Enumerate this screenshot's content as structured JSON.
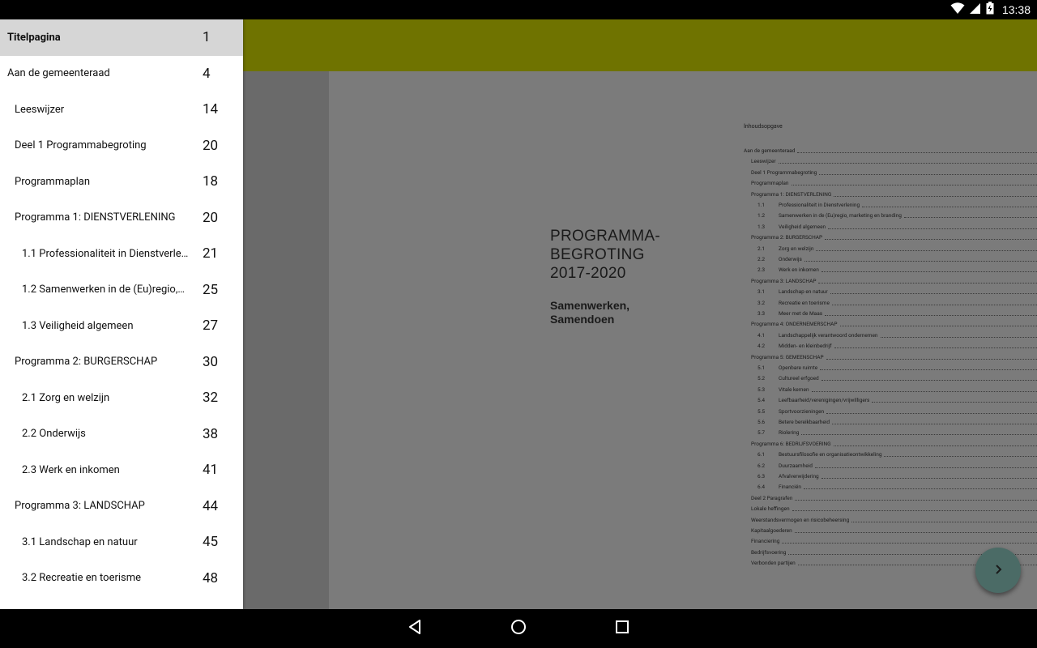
{
  "status_bar": {
    "time": "13:38"
  },
  "cover": {
    "title": "PROGRAMMA-\nBEGROTING\n2017-2020",
    "subtitle": "Samenwerken,\nSamendoen"
  },
  "drawer": {
    "items": [
      {
        "label": "Titelpagina",
        "page": "1"
      },
      {
        "label": "Aan de gemeenteraad",
        "page": "4"
      },
      {
        "label": "Leeswijzer",
        "page": "14"
      },
      {
        "label": "Deel 1 Programmabegroting",
        "page": "20"
      },
      {
        "label": "Programmaplan",
        "page": "18"
      },
      {
        "label": "Programma 1:  DIENSTVERLENING",
        "page": "20"
      },
      {
        "label": "1.1   Professionaliteit in Dienstverle…",
        "page": "21"
      },
      {
        "label": "1.2   Samenwerken in de (Eu)regio,…",
        "page": "25"
      },
      {
        "label": "1.3   Veiligheid algemeen",
        "page": "27"
      },
      {
        "label": "Programma 2:  BURGERSCHAP",
        "page": "30"
      },
      {
        "label": "2.1   Zorg en welzijn",
        "page": "32"
      },
      {
        "label": "2.2   Onderwijs",
        "page": "38"
      },
      {
        "label": "2.3   Werk en inkomen",
        "page": "41"
      },
      {
        "label": "Programma 3:  LANDSCHAP",
        "page": "44"
      },
      {
        "label": "3.1   Landschap en natuur",
        "page": "45"
      },
      {
        "label": "3.2   Recreatie en toerisme",
        "page": "48"
      }
    ]
  },
  "toc_page": {
    "heading": "Inhoudsopgave",
    "lines": [
      {
        "num": "",
        "text": "Aan de gemeenteraad"
      },
      {
        "num": "",
        "text": "Leeswijzer"
      },
      {
        "num": "",
        "text": "Deel 1  Programmabegroting"
      },
      {
        "num": "",
        "text": "Programmaplan"
      },
      {
        "num": "",
        "text": "Programma 1:  DIENSTVERLENING"
      },
      {
        "num": "1.1",
        "text": "Professionaliteit in Dienstverlening"
      },
      {
        "num": "1.2",
        "text": "Samenwerken in de (Eu)regio, marketing en branding"
      },
      {
        "num": "1.3",
        "text": "Veiligheid algemeen"
      },
      {
        "num": "",
        "text": "Programma 2:  BURGERSCHAP"
      },
      {
        "num": "2.1",
        "text": "Zorg en welzijn"
      },
      {
        "num": "2.2",
        "text": "Onderwijs"
      },
      {
        "num": "2.3",
        "text": "Werk en inkomen"
      },
      {
        "num": "",
        "text": "Programma 3:  LANDSCHAP"
      },
      {
        "num": "3.1",
        "text": "Landschap en natuur"
      },
      {
        "num": "3.2",
        "text": "Recreatie en toerisme"
      },
      {
        "num": "3.3",
        "text": "Meer met de Maas"
      },
      {
        "num": "",
        "text": "Programma 4:  ONDERNEMERSCHAP"
      },
      {
        "num": "4.1",
        "text": "Landschappelijk verantwoord ondernemen"
      },
      {
        "num": "4.2",
        "text": "Midden- en kleinbedrijf"
      },
      {
        "num": "",
        "text": "Programma 5:  GEMEENSCHAP"
      },
      {
        "num": "5.1",
        "text": "Openbare ruimte"
      },
      {
        "num": "5.2",
        "text": "Cultureel erfgoed"
      },
      {
        "num": "5.3",
        "text": "Vitale kernen"
      },
      {
        "num": "5.4",
        "text": "Leefbaarheid/verenigingen/vrijwilligers"
      },
      {
        "num": "5.5",
        "text": "Sportvoorzieningen"
      },
      {
        "num": "5.6",
        "text": "Betere bereikbaarheid"
      },
      {
        "num": "5.7",
        "text": "Riolering"
      },
      {
        "num": "",
        "text": "Programma 6:  BEDRIJFSVOERING"
      },
      {
        "num": "6.1",
        "text": "Bestuursfilosofie en organisatieontwikkeling"
      },
      {
        "num": "6.2",
        "text": "Duurzaamheid"
      },
      {
        "num": "6.3",
        "text": "Afvalverwijdering"
      },
      {
        "num": "6.4",
        "text": "Financiën"
      },
      {
        "num": "",
        "text": "Deel 2 Paragrafen"
      },
      {
        "num": "",
        "text": "Lokale heffingen"
      },
      {
        "num": "",
        "text": "Weerstandsvermogen en risicobeheersing"
      },
      {
        "num": "",
        "text": "Kapitaalgoederen"
      },
      {
        "num": "",
        "text": "Financiering"
      },
      {
        "num": "",
        "text": "Bedrijfsvoering"
      },
      {
        "num": "",
        "text": "Verbonden partijen"
      }
    ]
  },
  "colors": {
    "toolbar": "#6f7300",
    "fab": "#4b6b66",
    "drawer_active": "#d6d6d6"
  },
  "icons": {
    "status": [
      "wifi-icon",
      "signal-icon",
      "battery-icon"
    ],
    "nav": [
      "back-icon",
      "home-icon",
      "recents-icon"
    ],
    "fab": "chevron-right-icon"
  }
}
